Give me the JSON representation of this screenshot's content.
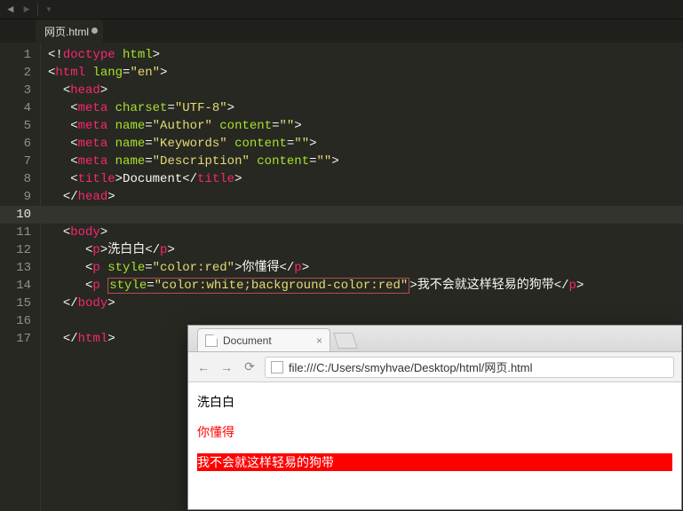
{
  "editor": {
    "tab_title": "网页.html",
    "tab_dirty": true,
    "current_line": 10,
    "lines": [
      {
        "n": 1,
        "frags": [
          {
            "c": "pun",
            "t": "<!"
          },
          {
            "c": "tag",
            "t": "doctype"
          },
          {
            "c": "txt",
            "t": " "
          },
          {
            "c": "attr",
            "t": "html"
          },
          {
            "c": "pun",
            "t": ">"
          }
        ]
      },
      {
        "n": 2,
        "frags": [
          {
            "c": "pun",
            "t": "<"
          },
          {
            "c": "tag",
            "t": "html"
          },
          {
            "c": "txt",
            "t": " "
          },
          {
            "c": "attr",
            "t": "lang"
          },
          {
            "c": "pun",
            "t": "="
          },
          {
            "c": "str",
            "t": "\"en\""
          },
          {
            "c": "pun",
            "t": ">"
          }
        ]
      },
      {
        "n": 3,
        "frags": [
          {
            "c": "txt",
            "t": "  "
          },
          {
            "c": "pun",
            "t": "<"
          },
          {
            "c": "tag",
            "t": "head"
          },
          {
            "c": "pun",
            "t": ">"
          }
        ]
      },
      {
        "n": 4,
        "frags": [
          {
            "c": "txt",
            "t": "   "
          },
          {
            "c": "pun",
            "t": "<"
          },
          {
            "c": "tag",
            "t": "meta"
          },
          {
            "c": "txt",
            "t": " "
          },
          {
            "c": "attr",
            "t": "charset"
          },
          {
            "c": "pun",
            "t": "="
          },
          {
            "c": "str",
            "t": "\"UTF-8\""
          },
          {
            "c": "pun",
            "t": ">"
          }
        ]
      },
      {
        "n": 5,
        "frags": [
          {
            "c": "txt",
            "t": "   "
          },
          {
            "c": "pun",
            "t": "<"
          },
          {
            "c": "tag",
            "t": "meta"
          },
          {
            "c": "txt",
            "t": " "
          },
          {
            "c": "attr",
            "t": "name"
          },
          {
            "c": "pun",
            "t": "="
          },
          {
            "c": "str",
            "t": "\"Author\""
          },
          {
            "c": "txt",
            "t": " "
          },
          {
            "c": "attr",
            "t": "content"
          },
          {
            "c": "pun",
            "t": "="
          },
          {
            "c": "str",
            "t": "\"\""
          },
          {
            "c": "pun",
            "t": ">"
          }
        ]
      },
      {
        "n": 6,
        "frags": [
          {
            "c": "txt",
            "t": "   "
          },
          {
            "c": "pun",
            "t": "<"
          },
          {
            "c": "tag",
            "t": "meta"
          },
          {
            "c": "txt",
            "t": " "
          },
          {
            "c": "attr",
            "t": "name"
          },
          {
            "c": "pun",
            "t": "="
          },
          {
            "c": "str",
            "t": "\"Keywords\""
          },
          {
            "c": "txt",
            "t": " "
          },
          {
            "c": "attr",
            "t": "content"
          },
          {
            "c": "pun",
            "t": "="
          },
          {
            "c": "str",
            "t": "\"\""
          },
          {
            "c": "pun",
            "t": ">"
          }
        ]
      },
      {
        "n": 7,
        "frags": [
          {
            "c": "txt",
            "t": "   "
          },
          {
            "c": "pun",
            "t": "<"
          },
          {
            "c": "tag",
            "t": "meta"
          },
          {
            "c": "txt",
            "t": " "
          },
          {
            "c": "attr",
            "t": "name"
          },
          {
            "c": "pun",
            "t": "="
          },
          {
            "c": "str",
            "t": "\"Description\""
          },
          {
            "c": "txt",
            "t": " "
          },
          {
            "c": "attr",
            "t": "content"
          },
          {
            "c": "pun",
            "t": "="
          },
          {
            "c": "str",
            "t": "\"\""
          },
          {
            "c": "pun",
            "t": ">"
          }
        ]
      },
      {
        "n": 8,
        "frags": [
          {
            "c": "txt",
            "t": "   "
          },
          {
            "c": "pun",
            "t": "<"
          },
          {
            "c": "tag",
            "t": "title"
          },
          {
            "c": "pun",
            "t": ">"
          },
          {
            "c": "txt",
            "t": "Document"
          },
          {
            "c": "pun",
            "t": "</"
          },
          {
            "c": "tag",
            "t": "title"
          },
          {
            "c": "pun",
            "t": ">"
          }
        ]
      },
      {
        "n": 9,
        "frags": [
          {
            "c": "txt",
            "t": "  "
          },
          {
            "c": "pun",
            "t": "</"
          },
          {
            "c": "tag",
            "t": "head"
          },
          {
            "c": "pun",
            "t": ">"
          }
        ]
      },
      {
        "n": 10,
        "frags": []
      },
      {
        "n": 11,
        "frags": [
          {
            "c": "txt",
            "t": "  "
          },
          {
            "c": "pun",
            "t": "<"
          },
          {
            "c": "tag",
            "t": "body"
          },
          {
            "c": "pun",
            "t": ">"
          }
        ]
      },
      {
        "n": 12,
        "frags": [
          {
            "c": "txt",
            "t": "     "
          },
          {
            "c": "pun",
            "t": "<"
          },
          {
            "c": "tag",
            "t": "p"
          },
          {
            "c": "pun",
            "t": ">"
          },
          {
            "c": "txt",
            "t": "洗白白"
          },
          {
            "c": "pun",
            "t": "</"
          },
          {
            "c": "tag",
            "t": "p"
          },
          {
            "c": "pun",
            "t": ">"
          }
        ]
      },
      {
        "n": 13,
        "frags": [
          {
            "c": "txt",
            "t": "     "
          },
          {
            "c": "pun",
            "t": "<"
          },
          {
            "c": "tag",
            "t": "p"
          },
          {
            "c": "txt",
            "t": " "
          },
          {
            "c": "attr",
            "t": "style"
          },
          {
            "c": "pun",
            "t": "="
          },
          {
            "c": "str",
            "t": "\"color:red\""
          },
          {
            "c": "pun",
            "t": ">"
          },
          {
            "c": "txt",
            "t": "你懂得"
          },
          {
            "c": "pun",
            "t": "</"
          },
          {
            "c": "tag",
            "t": "p"
          },
          {
            "c": "pun",
            "t": ">"
          }
        ]
      },
      {
        "n": 14,
        "frags": [
          {
            "c": "txt",
            "t": "     "
          },
          {
            "c": "pun",
            "t": "<"
          },
          {
            "c": "tag",
            "t": "p"
          },
          {
            "c": "txt",
            "t": " "
          },
          {
            "c": "attr",
            "t": "style",
            "box": true
          },
          {
            "c": "pun",
            "t": "=",
            "box": true
          },
          {
            "c": "str",
            "t": "\"color:white;background-color:red\"",
            "box": true
          },
          {
            "c": "pun",
            "t": ">"
          },
          {
            "c": "txt",
            "t": "我不会就这样轻易的狗带"
          },
          {
            "c": "pun",
            "t": "</"
          },
          {
            "c": "tag",
            "t": "p"
          },
          {
            "c": "pun",
            "t": ">"
          }
        ]
      },
      {
        "n": 15,
        "frags": [
          {
            "c": "txt",
            "t": "  "
          },
          {
            "c": "pun",
            "t": "</"
          },
          {
            "c": "tag",
            "t": "body"
          },
          {
            "c": "pun",
            "t": ">"
          }
        ]
      },
      {
        "n": 16,
        "frags": []
      },
      {
        "n": 17,
        "frags": [
          {
            "c": "txt",
            "t": "  "
          },
          {
            "c": "pun",
            "t": "</"
          },
          {
            "c": "tag",
            "t": "html"
          },
          {
            "c": "pun",
            "t": ">"
          }
        ]
      }
    ]
  },
  "browser": {
    "tab_title": "Document",
    "url": "file:///C:/Users/smyhvae/Desktop/html/网页.html",
    "p1": "洗白白",
    "p2": "你懂得",
    "p3": "我不会就这样轻易的狗带"
  }
}
